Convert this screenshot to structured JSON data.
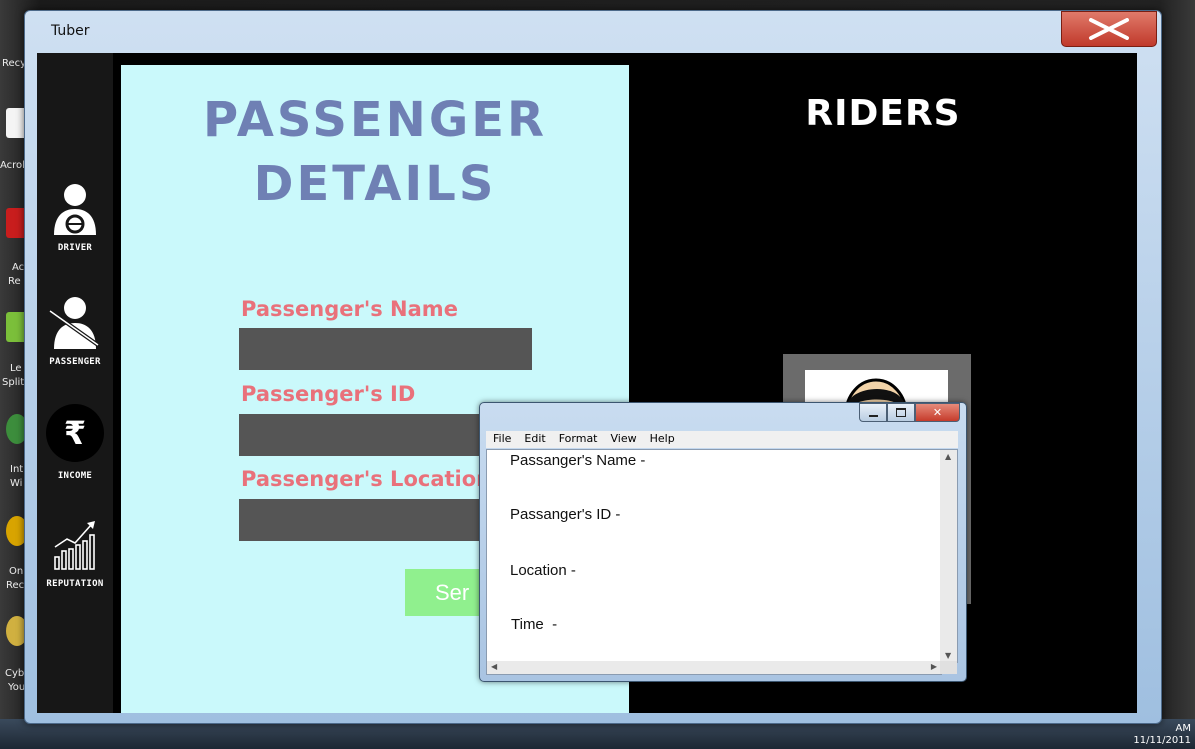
{
  "window": {
    "title": "Tuber"
  },
  "sidebar": {
    "items": [
      {
        "label": "DRIVER",
        "icon": "driver-icon"
      },
      {
        "label": "PASSENGER",
        "icon": "passenger-icon"
      },
      {
        "label": "INCOME",
        "icon": "rupee-icon"
      },
      {
        "label": "REPUTATION",
        "icon": "chart-growth-icon"
      }
    ]
  },
  "passenger_panel": {
    "title_line1": "PASSENGER",
    "title_line2": "DETAILS",
    "name_label": "Passenger's Name",
    "id_label": "Passenger's ID",
    "location_label": "Passenger's Location",
    "submit_label": "Ser"
  },
  "riders_panel": {
    "title": "RIDERS"
  },
  "notepad": {
    "menu": [
      "File",
      "Edit",
      "Format",
      "View",
      "Help"
    ],
    "lines": [
      "Passanger's Name -",
      "Passanger's ID -",
      "Location -",
      "Time  -"
    ]
  },
  "desktop": {
    "icon_labels": [
      "Recy",
      "Acrol",
      "Ac",
      "Re",
      "Le",
      "Split",
      "Int",
      "Wi",
      "On",
      "Rec",
      "Cyb",
      "You"
    ],
    "clock_time": "AM",
    "clock_date": "11/11/2011"
  },
  "colors": {
    "panel_left_bg": "#caf9fb",
    "title_color": "#6f80b4",
    "label_color": "#e9717b",
    "input_bg": "#555555",
    "submit_bg": "#90f08e",
    "close_button": "#c0392b"
  }
}
